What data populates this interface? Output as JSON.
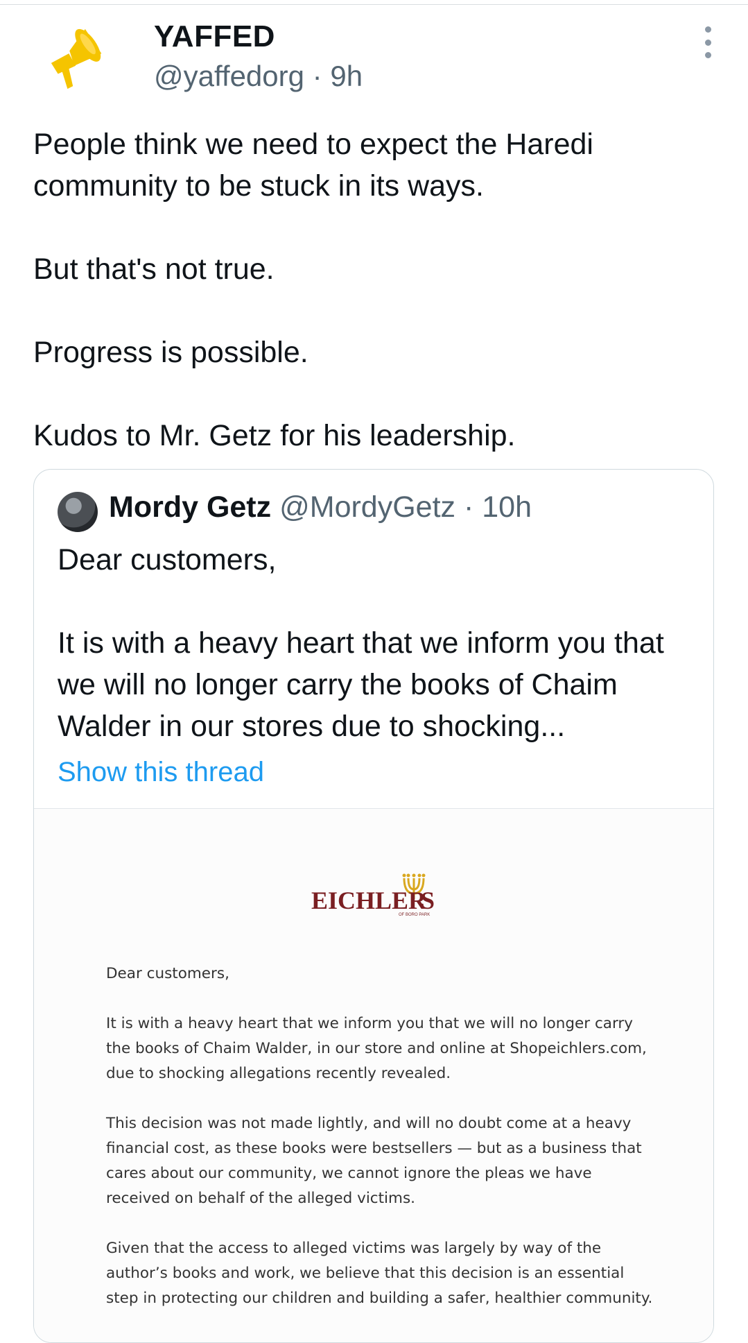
{
  "tweet": {
    "author_name": "YAFFED",
    "handle": "@yaffedorg",
    "separator": "·",
    "time": "9h",
    "paragraphs": [
      "People think we need to expect the Haredi community to be stuck in its ways.",
      "But that's not true.",
      "Progress is possible.",
      "Kudos to Mr. Getz for his leadership."
    ],
    "avatar_icon": "megaphone-icon",
    "more_icon": "more-vertical-icon"
  },
  "quote": {
    "author_name": "Mordy Getz",
    "handle": "@MordyGetz",
    "separator": "·",
    "time": "10h",
    "paragraphs": [
      "Dear customers,",
      "It is with a heavy heart that we inform you that we will no longer carry the books of Chaim Walder in our stores due to shocking..."
    ],
    "show_thread": "Show this thread"
  },
  "letter": {
    "logo_text": "EICHLER",
    "logo_tail": "S",
    "logo_sub": "OF BORO PARK",
    "paragraphs": [
      "Dear customers,",
      "It is with a heavy heart that we inform you that we will no longer carry the books of Chaim Walder, in our store and online at Shopeichlers.com, due to shocking allegations recently revealed.",
      "This decision was not made lightly, and will no doubt come at a heavy financial cost, as these books were bestsellers — but as a business that cares about our community, we cannot ignore the pleas we have received on behalf of the alleged victims.",
      "Given that the access to alleged victims was largely by way of the author’s books and work, we believe that this decision is an essential step in protecting our children and building a safer, healthier community."
    ]
  },
  "colors": {
    "text": "#0f1419",
    "secondary": "#536471",
    "link": "#1d9bf0",
    "megaphone": "#f5c400",
    "logo": "#7a1f22",
    "menorah": "#d9a820"
  }
}
